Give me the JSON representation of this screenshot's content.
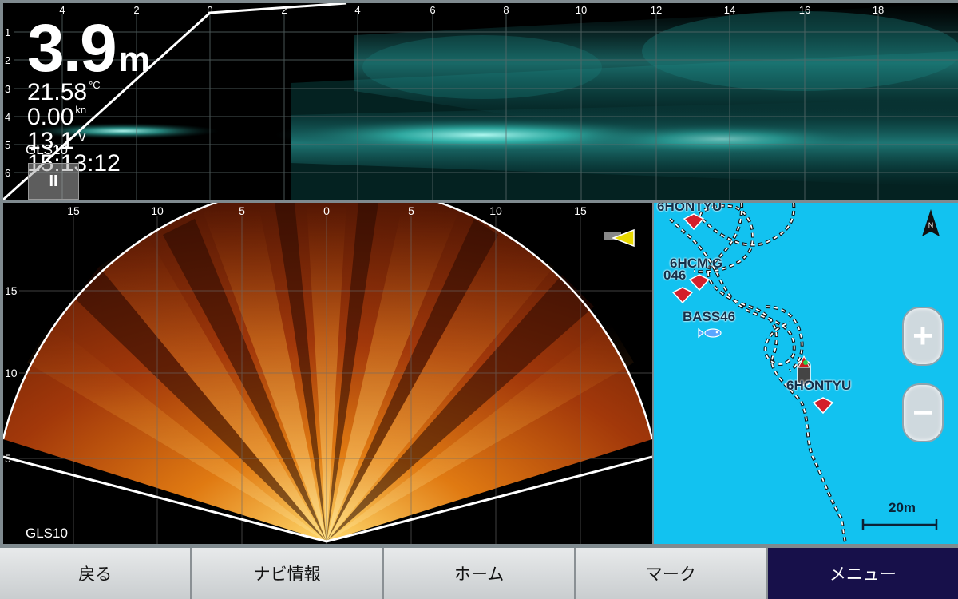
{
  "top_sonar": {
    "x_ticks": [
      "4",
      "2",
      "0",
      "2",
      "4",
      "6",
      "8",
      "10",
      "12",
      "14",
      "16",
      "18"
    ],
    "y_ticks": [
      "1",
      "2",
      "3",
      "4",
      "5",
      "6"
    ],
    "depth_value": "3.9",
    "depth_unit": "m",
    "water_temp": "21.58",
    "water_temp_unit": "°C",
    "speed": "0.00",
    "speed_unit": "kn",
    "voltage": "13.1",
    "voltage_unit": "v",
    "time": "15:13:12",
    "source": "GLS10",
    "pause_label": "II"
  },
  "live_sonar": {
    "x_ticks": [
      "15",
      "10",
      "5",
      "0",
      "5",
      "10",
      "15"
    ],
    "y_ticks": [
      "15",
      "10",
      "5"
    ],
    "source": "GLS10"
  },
  "map": {
    "north_label": "N",
    "waypoints": [
      {
        "label": "6HONTYU"
      },
      {
        "label": "6HCM.G"
      },
      {
        "label": "046"
      },
      {
        "label": "BASS46"
      },
      {
        "label": "6HONTYU"
      }
    ],
    "zoom_in": "+",
    "zoom_out": "−",
    "scale": "20m",
    "colors": {
      "water": "#12c2f0",
      "waypoint": "#d41f2a"
    }
  },
  "bottom_bar": {
    "buttons": [
      "戻る",
      "ナビ情報",
      "ホーム",
      "マーク",
      "メニュー"
    ],
    "active_index": 4
  }
}
